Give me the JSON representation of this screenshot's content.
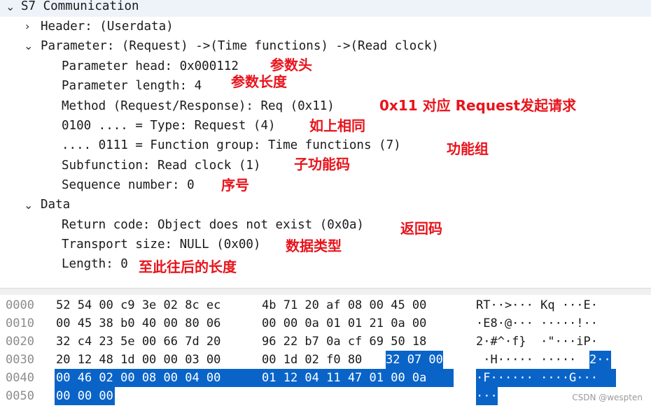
{
  "tree": {
    "root": "S7 Communication",
    "header": "Header: (Userdata)",
    "parameter": "Parameter: (Request) ->(Time functions) ->(Read clock)",
    "param_head": "Parameter head: 0x000112",
    "param_length": "Parameter length: 4",
    "method": "Method (Request/Response): Req (0x11)",
    "type": "0100 .... = Type: Request (4)",
    "func_group": ".... 0111 = Function group: Time functions (7)",
    "subfunction": "Subfunction: Read clock (1)",
    "sequence": "Sequence number: 0",
    "data": "Data",
    "return_code": "Return code: Object does not exist (0x0a)",
    "transport_size": "Transport size: NULL (0x00)",
    "length": "Length: 0"
  },
  "annotations": {
    "param_head": "参数头",
    "param_length": "参数长度",
    "method": "0x11 对应 Request发起请求",
    "type": "如上相同",
    "func_group": "功能组",
    "subfunction": "子功能码",
    "sequence": "序号",
    "return_code": "返回码",
    "transport_size": "数据类型",
    "length": "至此往后的长度"
  },
  "hex": {
    "rows": [
      {
        "offset": "0000",
        "a": "52 54 00 c9 3e 02 8c ec",
        "b": "4b 71 20 af 08 00 45 00",
        "ascii": "RT··>··· Kq ···E·"
      },
      {
        "offset": "0010",
        "a": "00 45 38 b0 40 00 80 06",
        "b": "00 00 0a 01 01 21 0a 00",
        "ascii": "·E8·@··· ·····!··"
      },
      {
        "offset": "0020",
        "a": "32 c4 23 5e 00 66 7d 20",
        "b": "96 22 b7 0a cf 69 50 18",
        "ascii": "2·#^·f}  ·\"···iP·"
      },
      {
        "offset": "0030",
        "a": "20 12 48 1d 00 00 03 00",
        "b1": "00 1d 02 f0 80 ",
        "b2": "32 07 00",
        "ascii1": " ·H····· ·····",
        "ascii2": "2··"
      },
      {
        "offset": "0040",
        "a": "00 46 02 00 08 00 04 00",
        "b": "01 12 04 11 47 01 00 0a",
        "ascii": "·F······ ····G···"
      },
      {
        "offset": "0050",
        "a": "00 00 00",
        "ascii": "···"
      }
    ]
  },
  "watermark": "CSDN @wespten",
  "colors": {
    "selection": "#0a64c8",
    "annotation": "#e8141c",
    "offset": "#8c8c8c"
  }
}
